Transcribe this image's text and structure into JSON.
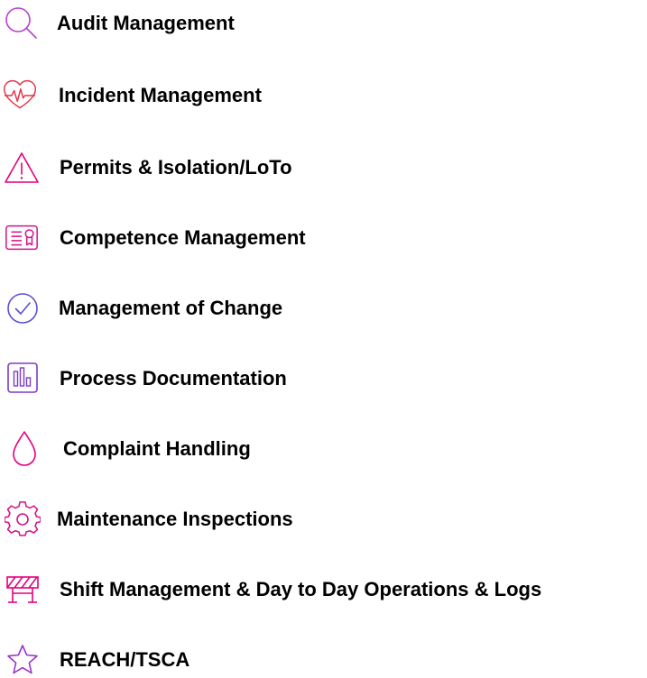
{
  "menu": {
    "items": [
      {
        "label": "Audit Management",
        "icon": "magnifier-icon"
      },
      {
        "label": "Incident Management",
        "icon": "heartbeat-icon"
      },
      {
        "label": "Permits & Isolation/LoTo",
        "icon": "warning-triangle-icon"
      },
      {
        "label": "Competence Management",
        "icon": "certificate-icon"
      },
      {
        "label": "Management of Change",
        "icon": "check-circle-icon"
      },
      {
        "label": "Process Documentation",
        "icon": "bar-chart-icon"
      },
      {
        "label": "Complaint Handling",
        "icon": "droplet-icon"
      },
      {
        "label": "Maintenance Inspections",
        "icon": "gear-icon"
      },
      {
        "label": "Shift Management & Day to Day Operations & Logs",
        "icon": "barrier-icon"
      },
      {
        "label": "REACH/TSCA",
        "icon": "star-icon"
      }
    ]
  },
  "colors": {
    "icon_pink": "#e4007c",
    "icon_red": "#e63247",
    "icon_magenta": "#d4148a",
    "icon_purple": "#7a3bc8",
    "icon_blue": "#3a5bd9",
    "icon_indigo": "#5b4fd6",
    "icon_violet": "#9b34c9",
    "text": "#000000"
  }
}
